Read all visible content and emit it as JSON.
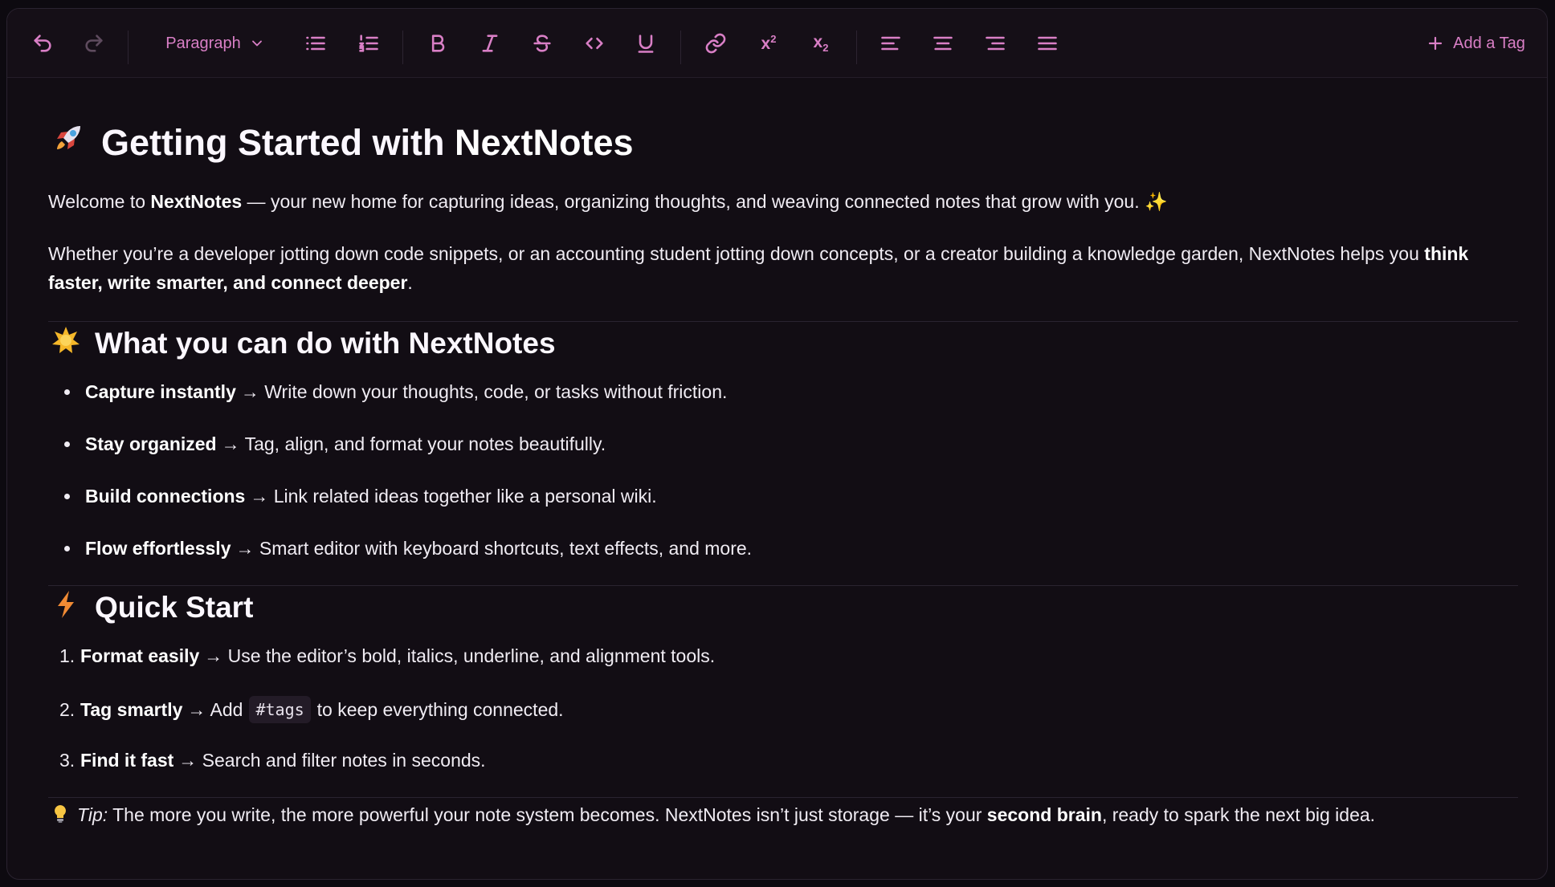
{
  "toolbar": {
    "block_type": "Paragraph",
    "add_tag": "Add a Tag",
    "superscript": {
      "base": "x",
      "mark": "2"
    },
    "subscript": {
      "base": "x",
      "mark": "2"
    }
  },
  "doc": {
    "title_prefix": "Getting Started with ",
    "title_brand": "NextNotes",
    "intro": {
      "before": "Welcome to ",
      "bold": "NextNotes",
      "after": " — your new home for capturing ideas, organizing thoughts, and weaving connected notes that grow with you. ✨"
    },
    "para2": {
      "before": "Whether you’re a developer jotting down code snippets, or an accounting student jotting down concepts, or a creator building a knowledge garden, NextNotes helps you ",
      "bold": "think faster, write smarter, and connect deeper",
      "after": "."
    },
    "section1_title": "What you can do with NextNotes",
    "features": [
      {
        "bold": "Capture instantly",
        "text": "→ Write down your thoughts, code, or tasks without friction."
      },
      {
        "bold": "Stay organized",
        "text": "→ Tag, align, and format your notes beautifully."
      },
      {
        "bold": "Build connections",
        "text": "→ Link related ideas together like a personal wiki."
      },
      {
        "bold": "Flow effortlessly",
        "text": "→ Smart editor with keyboard shortcuts, text effects, and more."
      }
    ],
    "section2_title": "Quick Start",
    "steps": [
      {
        "num": "1.",
        "bold": "Format easily",
        "text": "→ Use the editor’s bold, italics, underline, and alignment tools."
      },
      {
        "num": "2.",
        "bold": "Tag smartly",
        "text_before": "→ Add",
        "code": "#tags",
        "text": "to keep everything connected."
      },
      {
        "num": "3.",
        "bold": "Find it fast",
        "text": "→ Search and filter notes in seconds."
      }
    ],
    "tip": {
      "label": "Tip:",
      "before": " The more you write, the more powerful your note system becomes. NextNotes isn’t just storage — it’s your ",
      "bold": "second brain",
      "after": ", ready to spark the next big idea."
    }
  }
}
